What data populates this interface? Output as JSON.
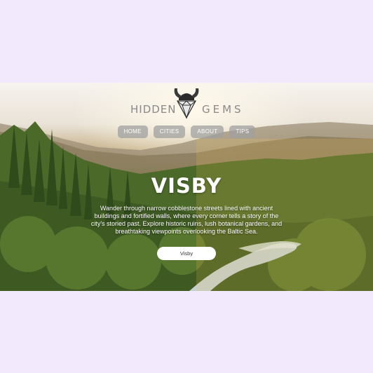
{
  "brand": {
    "left_word": "HIDDEN",
    "right_word": "GEMS"
  },
  "nav": {
    "items": [
      {
        "label": "HOME"
      },
      {
        "label": "CITIES"
      },
      {
        "label": "ABOUT"
      },
      {
        "label": "TIPS"
      }
    ]
  },
  "hero": {
    "title": "VISBY",
    "description": "Wander through narrow cobblestone streets lined with ancient buildings and fortified walls, where every corner tells a story of the city's storied past. Explore historic ruins, lush botanical gardens, and breathtaking viewpoints overlooking the Baltic Sea.",
    "button_label": "Visby"
  },
  "colors": {
    "page_background": "#f3e9fd",
    "nav_button": "#a0a0a0",
    "text": "#ffffff",
    "logo_text": "#8a8a8a"
  },
  "icons": {
    "logo": "viking-helmet-diamond-icon"
  }
}
